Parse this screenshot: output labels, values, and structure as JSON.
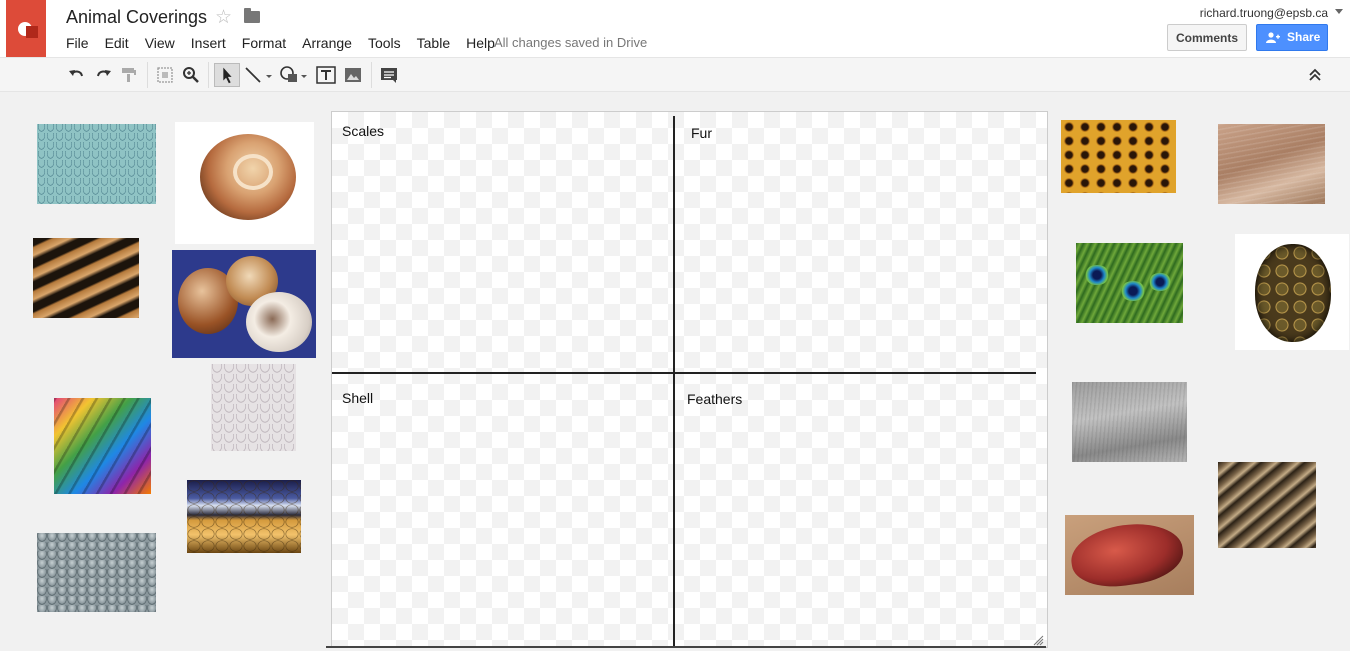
{
  "doc": {
    "title": "Animal Coverings",
    "save_status": "All changes saved in Drive"
  },
  "menu": [
    "File",
    "Edit",
    "View",
    "Insert",
    "Format",
    "Arrange",
    "Tools",
    "Table",
    "Help"
  ],
  "user": {
    "email": "richard.truong@epsb.ca"
  },
  "buttons": {
    "comments": "Comments",
    "share": "Share"
  },
  "quadrants": {
    "scales": "Scales",
    "fur": "Fur",
    "shell": "Shell",
    "feathers": "Feathers"
  },
  "colors": {
    "brand": "#dd4b39",
    "share": "#4d90fe"
  },
  "toolbar_icons": [
    "undo-icon",
    "redo-icon",
    "paint-format-icon",
    "select-all-icon",
    "zoom-icon",
    "select-pointer-icon",
    "line-icon",
    "shape-icon",
    "text-box-icon",
    "image-icon",
    "comment-icon",
    "collapse-icon"
  ]
}
